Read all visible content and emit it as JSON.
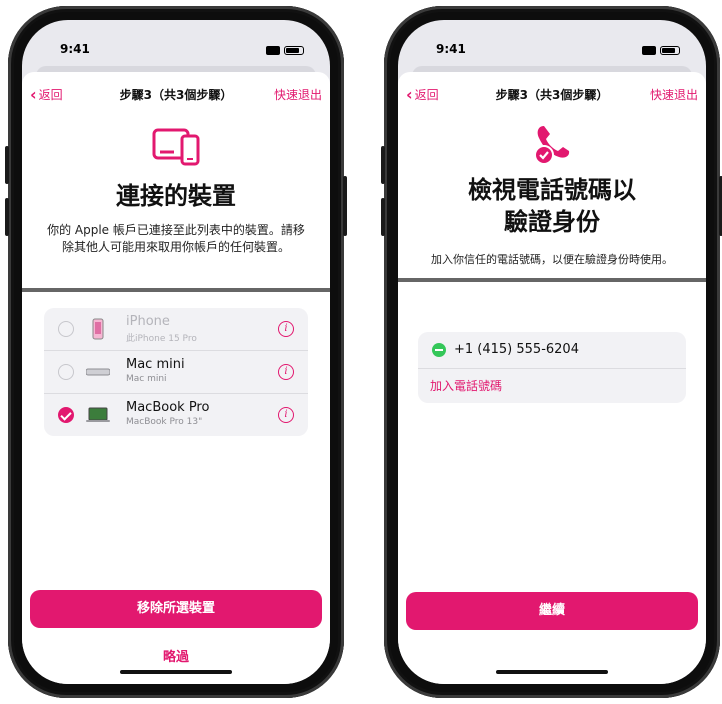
{
  "colors": {
    "accent": "#e2186f",
    "success": "#34c759"
  },
  "left_screen": {
    "status_time": "9:41",
    "nav": {
      "back_label": "返回",
      "title": "步驟3（共3個步驟）",
      "exit_label": "快速退出"
    },
    "hero_icon": "devices-icon",
    "headline": "連接的裝置",
    "description": "你的 Apple 帳戶已連接至此列表中的裝置。請移除其他人可能用來取用你帳戶的任何裝置。",
    "devices": [
      {
        "name": "iPhone",
        "model": "此iPhone 15 Pro",
        "selected": false,
        "disabled": true,
        "icon": "iphone-icon"
      },
      {
        "name": "Mac mini",
        "model": "Mac mini",
        "selected": false,
        "disabled": false,
        "icon": "mac-mini-icon"
      },
      {
        "name": "MacBook Pro",
        "model": "MacBook Pro 13\"",
        "selected": true,
        "disabled": false,
        "icon": "macbook-icon"
      }
    ],
    "primary_button": "移除所選裝置",
    "skip_button": "略過"
  },
  "right_screen": {
    "status_time": "9:41",
    "nav": {
      "back_label": "返回",
      "title": "步驟3（共3個步驟）",
      "exit_label": "快速退出"
    },
    "hero_icon": "phone-checkmark-icon",
    "headline_line1": "檢視電話號碼以",
    "headline_line2": "驗證身份",
    "description": "加入你信任的電話號碼，以便在驗證身份時使用。",
    "phone_number": "+1 (415) 555-6204",
    "add_phone_label": "加入電話號碼",
    "primary_button": "繼續"
  }
}
